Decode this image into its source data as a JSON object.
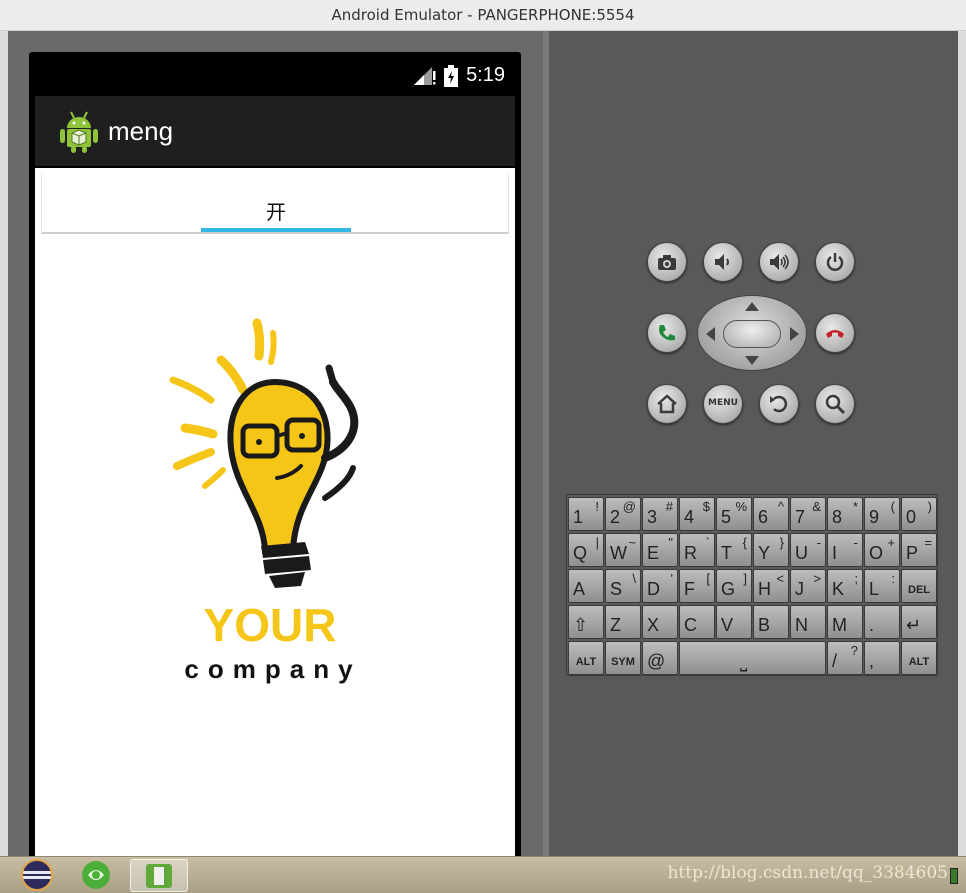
{
  "window": {
    "title": "Android Emulator - PANGERPHONE:5554"
  },
  "status_bar": {
    "time": "5:19"
  },
  "action_bar": {
    "app_title": "meng"
  },
  "tabs": [
    {
      "label": "开",
      "selected": true
    }
  ],
  "logo": {
    "word1": "YOUR",
    "word2": "company"
  },
  "hardware_buttons": {
    "row1": [
      "camera-icon",
      "volume-down-icon",
      "volume-up-icon",
      "power-icon"
    ],
    "row2": [
      "call-icon",
      "dpad",
      "end-call-icon"
    ],
    "row3": [
      "home-icon",
      "menu-button",
      "back-icon",
      "search-icon"
    ],
    "menu_label": "MENU"
  },
  "keyboard": {
    "row1": [
      {
        "main": "1",
        "alt": "!"
      },
      {
        "main": "2",
        "alt": "@"
      },
      {
        "main": "3",
        "alt": "#"
      },
      {
        "main": "4",
        "alt": "$"
      },
      {
        "main": "5",
        "alt": "%"
      },
      {
        "main": "6",
        "alt": "^"
      },
      {
        "main": "7",
        "alt": "&"
      },
      {
        "main": "8",
        "alt": "*"
      },
      {
        "main": "9",
        "alt": "("
      },
      {
        "main": "0",
        "alt": ")"
      }
    ],
    "row2": [
      {
        "main": "Q",
        "alt": "|"
      },
      {
        "main": "W",
        "alt": "~"
      },
      {
        "main": "E",
        "alt": "\""
      },
      {
        "main": "R",
        "alt": "`"
      },
      {
        "main": "T",
        "alt": "{"
      },
      {
        "main": "Y",
        "alt": "}"
      },
      {
        "main": "U",
        "alt": "-"
      },
      {
        "main": "I",
        "alt": "-"
      },
      {
        "main": "O",
        "alt": "+"
      },
      {
        "main": "P",
        "alt": "="
      }
    ],
    "row3": [
      {
        "main": "A",
        "alt": ""
      },
      {
        "main": "S",
        "alt": "\\"
      },
      {
        "main": "D",
        "alt": "'"
      },
      {
        "main": "F",
        "alt": "["
      },
      {
        "main": "G",
        "alt": "]"
      },
      {
        "main": "H",
        "alt": "<"
      },
      {
        "main": "J",
        "alt": ">"
      },
      {
        "main": "K",
        "alt": ";"
      },
      {
        "main": "L",
        "alt": ":"
      },
      {
        "main": "DEL",
        "alt": ""
      }
    ],
    "row4": [
      {
        "main": "⇧",
        "alt": ""
      },
      {
        "main": "Z",
        "alt": ""
      },
      {
        "main": "X",
        "alt": ""
      },
      {
        "main": "C",
        "alt": ""
      },
      {
        "main": "V",
        "alt": ""
      },
      {
        "main": "B",
        "alt": ""
      },
      {
        "main": "N",
        "alt": ""
      },
      {
        "main": "M",
        "alt": ""
      },
      {
        "main": ".",
        "alt": ""
      },
      {
        "main": "↵",
        "alt": ""
      }
    ],
    "row5": {
      "alt_left": "ALT",
      "sym": "SYM",
      "at": "@",
      "space": "⎵",
      "slash": "/",
      "slash_alt": "?",
      "comma": ",",
      "alt_right": "ALT"
    }
  },
  "taskbar": {
    "watermark": "http://blog.csdn.net/qq_3384605"
  },
  "colors": {
    "tab_indicator": "#33b5e5",
    "logo_yellow": "#f5c518",
    "action_bar": "#1f1f1f",
    "call_green": "#1f8a3a",
    "end_call_red": "#c0272d"
  }
}
